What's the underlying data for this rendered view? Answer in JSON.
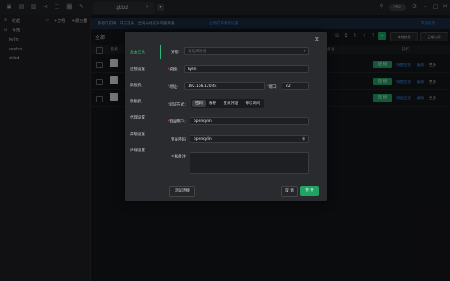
{
  "tab": {
    "title": "qkbd"
  },
  "topbar": {
    "pro_badge": "PRO"
  },
  "sidebar": {
    "header": "收起",
    "add_group": "+分组",
    "add_server": "+服务器",
    "root": "全部",
    "items": [
      "kylin",
      "centos",
      "qkbd"
    ]
  },
  "notice": {
    "text": "多窗口支持、日志记录、全局分组成员的服务器... ",
    "link": "立即打开更新设置",
    "right": "不再提示"
  },
  "main": {
    "all_label": "全部",
    "btn_local_shortcut": "本地快捷",
    "btn_cloud_sync": "云端公网",
    "columns": [
      "系统",
      "备注",
      "操作"
    ],
    "rows": [
      {
        "connect": "连 接",
        "link1": "快捷连接",
        "link2": "编辑",
        "more": "更多"
      },
      {
        "connect": "连 接",
        "link1": "快捷连接",
        "link2": "编辑",
        "more": "更多"
      },
      {
        "connect": "连 接",
        "link1": "快捷连接",
        "link2": "编辑",
        "more": "更多"
      }
    ]
  },
  "dialog": {
    "nav": [
      "基本信息",
      "连接设置",
      "跳板机",
      "跳板机",
      "代理设置",
      "高级设置",
      "终端设置"
    ],
    "group_label": "分组:",
    "group_placeholder": "请选择分组",
    "name_label": "名称:",
    "name_value": "kylin",
    "address_label": "地址:",
    "address_value": "192.168.120.44",
    "port_label": "端口:",
    "port_value": "22",
    "auth_label": "验证方式:",
    "auth_options": [
      "密码",
      "秘钥",
      "登录凭证",
      "每次询问"
    ],
    "user_label": "登录用户:",
    "user_value": "openkylin",
    "password_label": "登录密码:",
    "password_value": "openkylin",
    "remark_label": "主机备注:",
    "test_button": "测试连接",
    "cancel_button": "取 消",
    "save_button": "保 存"
  }
}
